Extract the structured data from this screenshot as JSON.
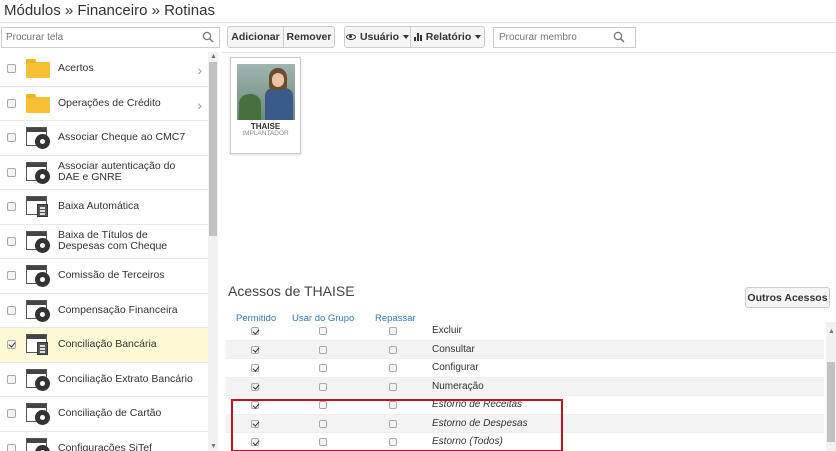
{
  "breadcrumb": "Módulos » Financeiro » Rotinas",
  "left_search": {
    "placeholder": "Procurar tela"
  },
  "left_items": [
    {
      "label": "Acertos",
      "icon": "folder-icon",
      "checked": false,
      "selected": false,
      "chevron": true
    },
    {
      "label": "Operações de Crédito",
      "icon": "folder-icon",
      "checked": false,
      "selected": false,
      "chevron": true
    },
    {
      "label": "Associar Cheque ao CMC7",
      "icon": "window-gear-icon",
      "checked": false,
      "selected": false
    },
    {
      "label": "Associar autenticação do DAE e GNRE",
      "icon": "window-gear-icon",
      "checked": false,
      "selected": false
    },
    {
      "label": "Baixa Automática",
      "icon": "window-calc-icon",
      "checked": false,
      "selected": false
    },
    {
      "label": "Baixa de Títulos de Despesas com Cheque",
      "icon": "window-gear-icon",
      "checked": false,
      "selected": false
    },
    {
      "label": "Comissão de Terceiros",
      "icon": "window-gear-icon",
      "checked": false,
      "selected": false
    },
    {
      "label": "Compensação Financeira",
      "icon": "window-gear-icon",
      "checked": false,
      "selected": false
    },
    {
      "label": "Conciliação Bancária",
      "icon": "window-calc-icon",
      "checked": true,
      "selected": true
    },
    {
      "label": "Conciliação Extrato Bancário",
      "icon": "window-gear-icon",
      "checked": false,
      "selected": false
    },
    {
      "label": "Conciliação de Cartão",
      "icon": "window-gear-icon",
      "checked": false,
      "selected": false
    },
    {
      "label": "Configurações SiTef",
      "icon": "window-gear-icon",
      "checked": false,
      "selected": false
    }
  ],
  "toolbar": {
    "add_label": "Adicionar",
    "remove_label": "Remover",
    "user_label": "Usuário",
    "report_label": "Relatório",
    "member_search_placeholder": "Procurar membro"
  },
  "member": {
    "name": "THAISE",
    "role": "IMPLANTADOR"
  },
  "access": {
    "title": "Acessos de THAISE",
    "other_button": "Outros Acessos",
    "columns": {
      "permitido": "Permitido",
      "grupo": "Usar do Grupo",
      "repassar": "Repassar"
    },
    "rows": [
      {
        "label": "Excluir",
        "permitido": true,
        "grupo": false,
        "repassar": false,
        "italic": false
      },
      {
        "label": "Consultar",
        "permitido": true,
        "grupo": false,
        "repassar": false,
        "italic": false
      },
      {
        "label": "Configurar",
        "permitido": true,
        "grupo": false,
        "repassar": false,
        "italic": false
      },
      {
        "label": "Numeração",
        "permitido": true,
        "grupo": false,
        "repassar": false,
        "italic": false
      },
      {
        "label": "Estorno de Receitas",
        "permitido": true,
        "grupo": false,
        "repassar": false,
        "italic": true
      },
      {
        "label": "Estorno de Despesas",
        "permitido": true,
        "grupo": false,
        "repassar": false,
        "italic": true
      },
      {
        "label": "Estorno (Todos)",
        "permitido": true,
        "grupo": false,
        "repassar": false,
        "italic": true
      }
    ]
  },
  "colors": {
    "highlight": "#c1121f",
    "selected_row": "#fdfbd5",
    "column_header": "#337ab7"
  }
}
